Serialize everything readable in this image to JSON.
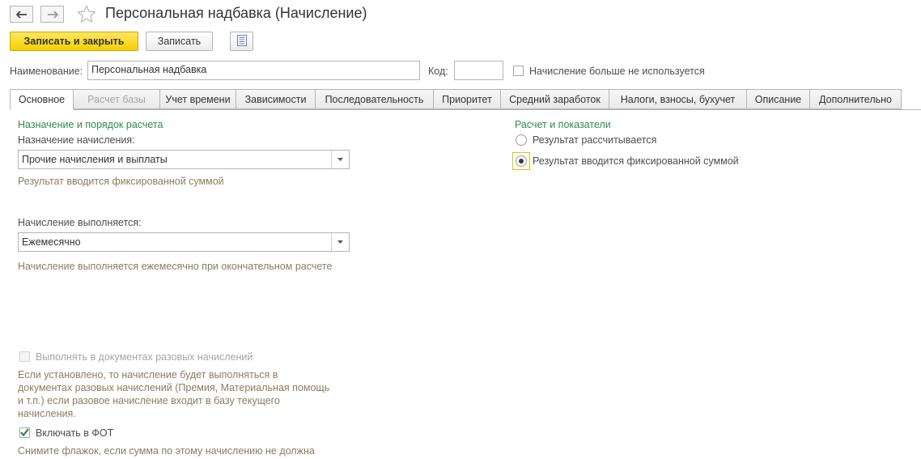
{
  "header": {
    "back_icon": "arrow-left-icon",
    "forward_icon": "arrow-right-icon",
    "star_icon": "star-outline-icon",
    "title": "Персональная надбавка (Начисление)"
  },
  "toolbar": {
    "save_close_label": "Записать и закрыть",
    "save_label": "Записать",
    "list_icon": "document-list-icon"
  },
  "fields": {
    "name_label": "Наименование:",
    "name_value": "Персональная надбавка",
    "code_label": "Код:",
    "code_value": "",
    "unused_label": "Начисление больше не используется",
    "unused_checked": false
  },
  "tabs": [
    {
      "label": "Основное",
      "active": true
    },
    {
      "label": "Расчет базы",
      "disabled": true
    },
    {
      "label": "Учет времени"
    },
    {
      "label": "Зависимости"
    },
    {
      "label": "Последовательность"
    },
    {
      "label": "Приоритет"
    },
    {
      "label": "Средний заработок"
    },
    {
      "label": "Налоги, взносы, бухучет"
    },
    {
      "label": "Описание"
    },
    {
      "label": "Дополнительно"
    }
  ],
  "left": {
    "section_title": "Назначение и порядок расчета",
    "purpose_label": "Назначение начисления:",
    "purpose_value": "Прочие начисления и выплаты",
    "purpose_hint": "Результат вводится фиксированной суммой",
    "schedule_label": "Начисление выполняется:",
    "schedule_value": "Ежемесячно",
    "schedule_hint": "Начисление выполняется ежемесячно при окончательном расчете",
    "onetime_label": "Выполнять в документах разовых начислений",
    "onetime_hint_lines": [
      "Если установлено, то начисление будет выполняться в",
      "документах разовых начислений (Премия, Материальная помощь",
      "и т.п.) если разовое начисление входит в базу текущего",
      "начисления."
    ],
    "fot_label": "Включать в ФОТ",
    "fot_checked": true,
    "fot_hint": "Снимите флажок, если сумма по этому начислению не должна"
  },
  "right": {
    "section_title": "Расчет и показатели",
    "radio_calculated": "Результат рассчитывается",
    "radio_fixed": "Результат вводится фиксированной суммой",
    "selected": "fixed"
  },
  "colors": {
    "primary_button": "#f6d000",
    "section_title": "#2e8b4f",
    "hint_text": "#8d7b61",
    "disabled_text": "#a6a6a6"
  }
}
